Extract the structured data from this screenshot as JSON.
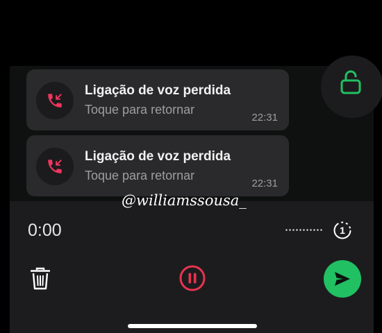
{
  "notifications": [
    {
      "title": "Ligação de voz perdida",
      "subtitle": "Toque para retornar",
      "time": "22:31"
    },
    {
      "title": "Ligação de voz perdida",
      "subtitle": "Toque para retornar",
      "time": "22:31"
    }
  ],
  "watermark": "@williamssousa_",
  "recorder": {
    "timer": "0:00",
    "view_once_label": "1"
  },
  "colors": {
    "accent_missed": "#f0365e",
    "lock_green": "#21c063",
    "send_green": "#21c063",
    "pause_red": "#e8344e"
  },
  "icons": {
    "missed_call": "missed-call-icon",
    "lock": "unlock-icon",
    "trash": "trash-icon",
    "pause": "pause-icon",
    "send": "send-icon",
    "view_once": "view-once-icon"
  }
}
